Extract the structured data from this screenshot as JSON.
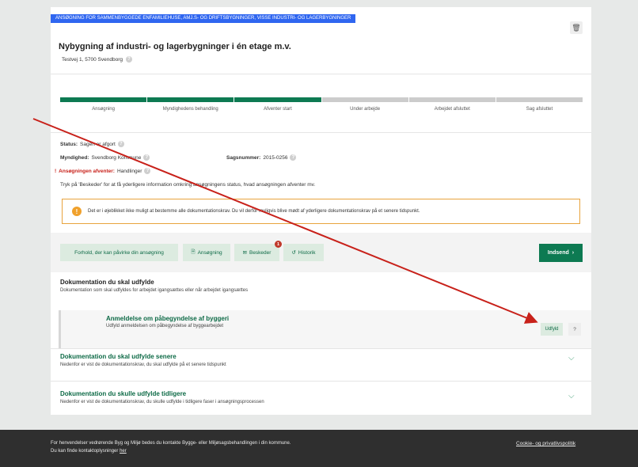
{
  "banner": "ANSØGNING FOR SAMMENBYGGEDE ENFAMILIEHUSE, AMJ.S- OG DRIFTSBYGNINGER, VISSE INDUSTRI- OG LAGERBYGNINGER",
  "title": "Nybygning af industri- og lagerbygninger i én etage m.v.",
  "address": "Testvej 1, 5700 Svendborg",
  "steps": [
    {
      "label": "Ansøgning",
      "done": true
    },
    {
      "label": "Myndighedens behandling",
      "done": true
    },
    {
      "label": "Afventer start",
      "done": true
    },
    {
      "label": "Under arbejde",
      "done": false
    },
    {
      "label": "Arbejdet afsluttet",
      "done": false
    },
    {
      "label": "Sag afsluttet",
      "done": false
    }
  ],
  "status": {
    "label": "Status:",
    "value": "Sagen er afgort"
  },
  "myndighed": {
    "label": "Myndighed:",
    "value": "Svendborg Kommune"
  },
  "sagsnummer": {
    "label": "Sagsnummer:",
    "value": "2015-0256"
  },
  "afventer": {
    "prefix": "!",
    "label": "Ansøgningen afventer:",
    "value": "Handlinger"
  },
  "hint": "Tryk på 'Beskeder' for at få yderligere information omkring ansøgningens status, hvad ansøgningen afventer mv.",
  "warning": "Det er i øjeblikket ikke muligt at bestemme alle dokumentationskrav. Du vil derfor muligvis blive mødt af yderligere dokumentationskrav på et senere tidspunkt.",
  "warning_icon": "!",
  "toolbar": {
    "forhold": "Forhold, der kan påvirke din ansøgning",
    "ansogning": "Ansøgning",
    "beskeder": "Beskeder",
    "beskeder_badge": "1",
    "historik": "Historik",
    "indsend": "Indsend"
  },
  "doc_now": {
    "title": "Dokumentation du skal udfylde",
    "subtitle": "Dokumentation som skal udfyldes for arbejdet igangsættes eller når arbejdet igangsættes",
    "item_title": "Anmeldelse om påbegyndelse af byggeri",
    "item_subtitle": "Udfyld anmeldelsen om påbegyndelse af byggearbejdet",
    "udfyld": "Udfyld",
    "help": "?"
  },
  "doc_later": {
    "title": "Dokumentation du skal udfylde senere",
    "subtitle": "Nedenfor er vist de dokumentationskrav, du skal udfylde på et senere tidspunkt"
  },
  "doc_earlier": {
    "title": "Dokumentation du skulle udfylde tidligere",
    "subtitle": "Nedenfor er vist de dokumentationskrav, du skulle udfylde i tidligere faser i ansøgningsprocessen"
  },
  "footer": {
    "line1": "For henvendelser vedrørende Byg og Miljø bedes du kontakte Bygge- eller Miljøsagsbehandlingen i din kommune.",
    "line2": "Du kan finde kontaktoplysninger",
    "line2_link": "her",
    "cookie": "Cookie- og privatlivspolitik"
  },
  "colors": {
    "green": "#0d7a52",
    "banner": "#2f66f0",
    "warning": "#e8a33d",
    "arrow": "#c8211a"
  }
}
